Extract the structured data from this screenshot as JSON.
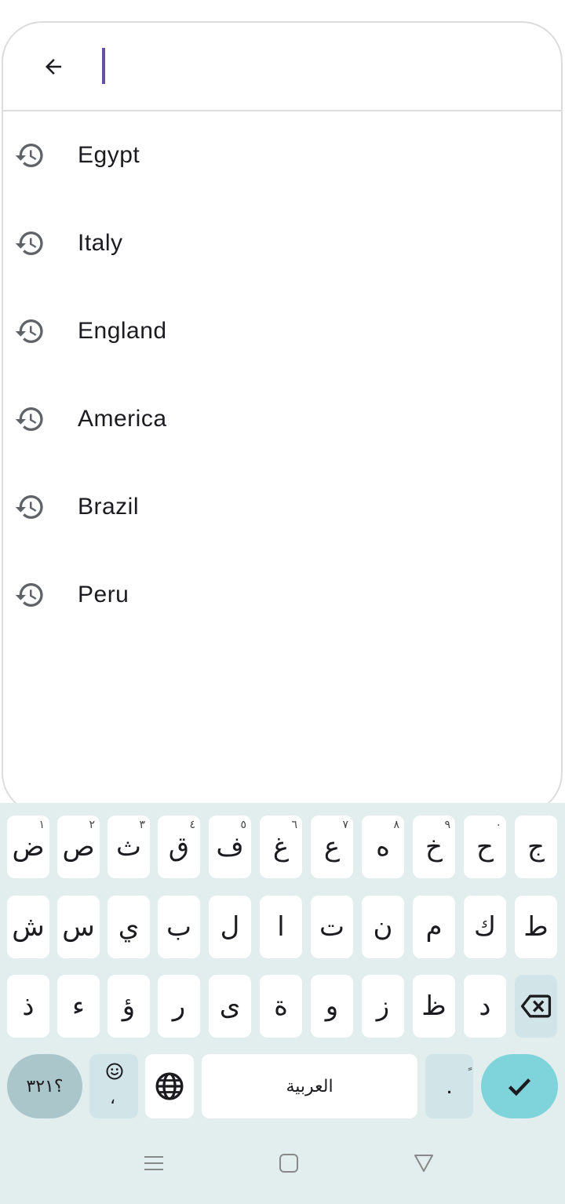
{
  "search": {
    "value": "",
    "placeholder": ""
  },
  "history": [
    {
      "label": "Egypt",
      "icon": "history-icon"
    },
    {
      "label": "Italy",
      "icon": "history-icon"
    },
    {
      "label": "England",
      "icon": "history-icon"
    },
    {
      "label": "America",
      "icon": "history-icon"
    },
    {
      "label": "Brazil",
      "icon": "history-icon"
    },
    {
      "label": "Peru",
      "icon": "history-icon"
    }
  ],
  "keyboard": {
    "row1": [
      {
        "char": "ض",
        "hint": "١"
      },
      {
        "char": "ص",
        "hint": "٢"
      },
      {
        "char": "ث",
        "hint": "٣"
      },
      {
        "char": "ق",
        "hint": "٤"
      },
      {
        "char": "ف",
        "hint": "٥"
      },
      {
        "char": "غ",
        "hint": "٦"
      },
      {
        "char": "ع",
        "hint": "٧"
      },
      {
        "char": "ه",
        "hint": "٨"
      },
      {
        "char": "خ",
        "hint": "٩"
      },
      {
        "char": "ح",
        "hint": "٠"
      },
      {
        "char": "ج",
        "hint": ""
      }
    ],
    "row2": [
      "ش",
      "س",
      "ي",
      "ب",
      "ل",
      "ا",
      "ت",
      "ن",
      "م",
      "ك",
      "ط"
    ],
    "row3": [
      "ذ",
      "ء",
      "ؤ",
      "ر",
      "ى",
      "ة",
      "و",
      "ز",
      "ظ",
      "د"
    ],
    "mode_label": "؟٣٢١",
    "emoji_secondary": "،",
    "space_label": "العربية",
    "period_label": ".",
    "period_hint": "ٍ",
    "accent_color": "#7fd4db",
    "background_color": "#e2eeee"
  },
  "colors": {
    "cursor": "#6750a4",
    "text": "#1c1b1f",
    "icon": "#5f6368"
  }
}
